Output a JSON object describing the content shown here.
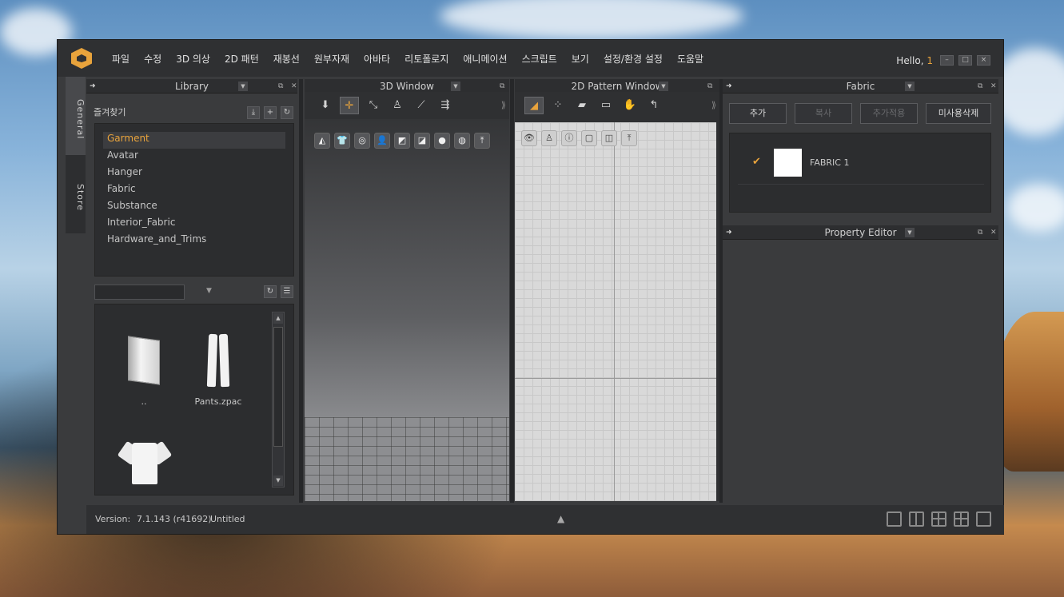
{
  "menu": {
    "items": [
      "파일",
      "수정",
      "3D 의상",
      "2D 패턴",
      "재봉선",
      "원부자재",
      "아바타",
      "리토폴로지",
      "애니메이션",
      "스크립트",
      "보기",
      "설정/환경 설정",
      "도움말"
    ],
    "greeting": "Hello,",
    "user_number": "1"
  },
  "side_tabs": [
    "General",
    "Store"
  ],
  "library": {
    "title": "Library",
    "favorites_label": "즐겨찾기",
    "tree": [
      "Garment",
      "Avatar",
      "Hanger",
      "Fabric",
      "Substance",
      "Interior_Fabric",
      "Hardware_and_Trims"
    ],
    "selected": "Garment",
    "files": [
      {
        "name": "..",
        "icon": "folder-icon"
      },
      {
        "name": "Pants.zpac",
        "icon": "pants-icon"
      },
      {
        "name": "",
        "icon": "tshirt-icon"
      }
    ]
  },
  "window3d": {
    "title": "3D Window"
  },
  "window2d": {
    "title": "2D Pattern Window"
  },
  "fabric": {
    "title": "Fabric",
    "buttons": [
      "추가",
      "복사",
      "추가적용",
      "미사용삭제"
    ],
    "disabled": [
      false,
      true,
      true,
      false
    ],
    "items": [
      {
        "name": "FABRIC 1",
        "color": "#ffffff",
        "checked": true
      }
    ]
  },
  "property_editor": {
    "title": "Property Editor"
  },
  "status": {
    "version_label": "Version:",
    "version": "7.1.143 (r41692)",
    "file": "Untitled"
  },
  "colors": {
    "accent": "#e8a33c",
    "panel": "#3a3b3d",
    "dark": "#2f3032"
  }
}
